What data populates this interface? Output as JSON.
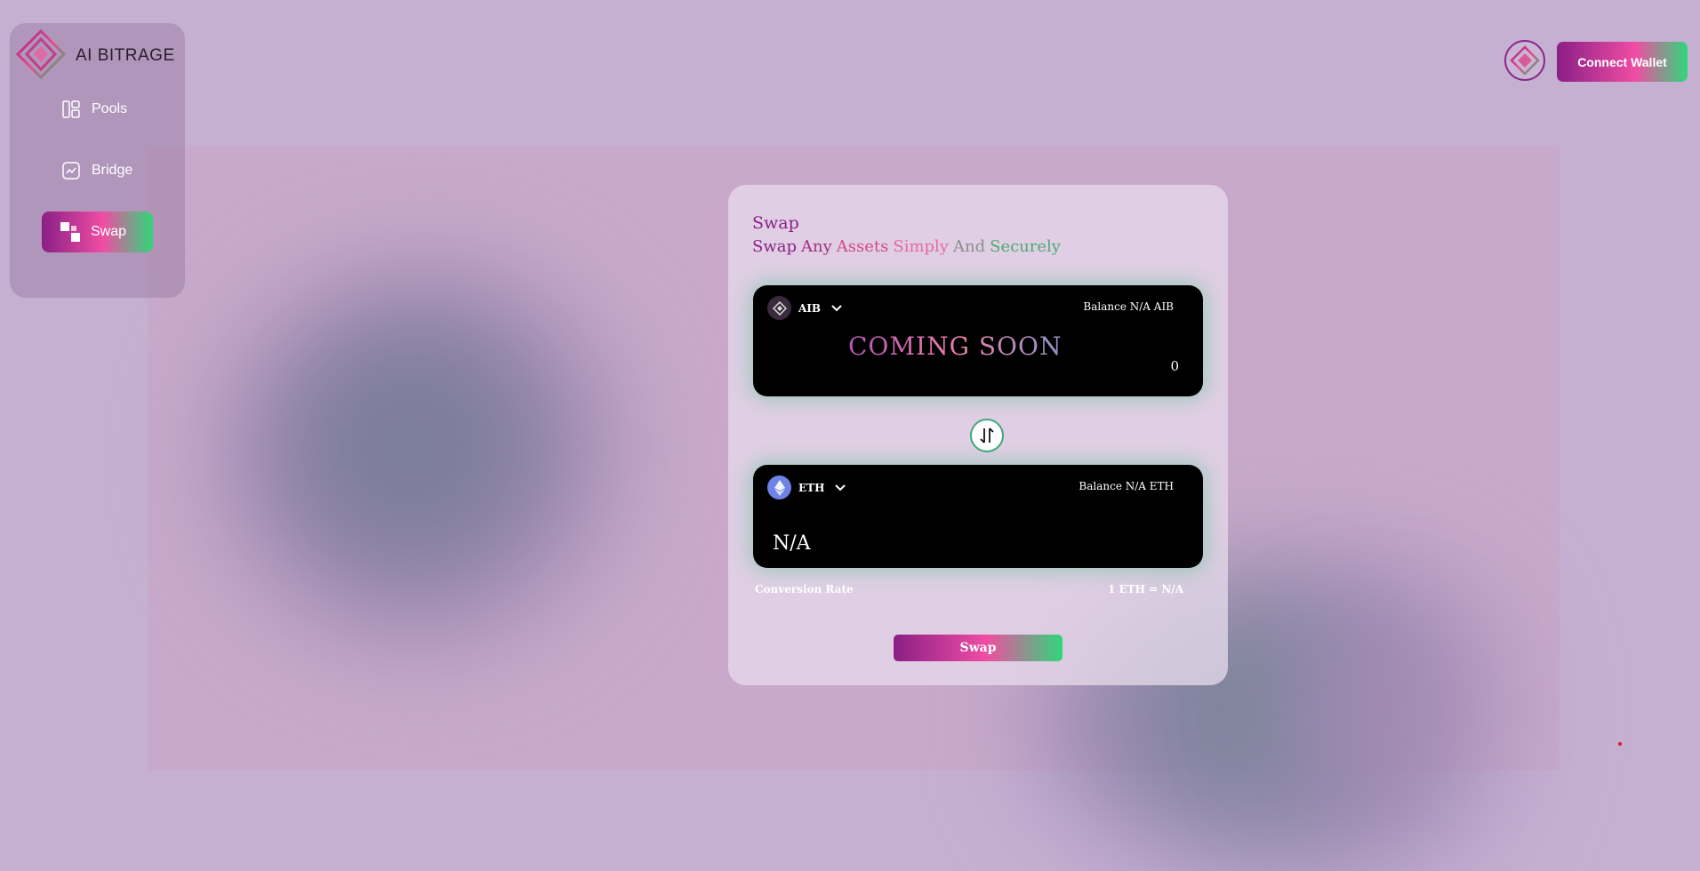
{
  "brand": {
    "name": "AI BITRAGE",
    "logo_icon": "diamond-logo-icon"
  },
  "sidebar": {
    "items": [
      {
        "label": "Pools",
        "icon": "pools-icon"
      },
      {
        "label": "Bridge",
        "icon": "bridge-icon"
      },
      {
        "label": "Swap",
        "icon": "swap-icon",
        "active": true
      }
    ]
  },
  "header": {
    "connect_label": "Connect Wallet"
  },
  "swap_card": {
    "title": "Swap",
    "subtitle_words": [
      "Swap",
      "Any",
      "Assets",
      "Simply",
      "And",
      "Securely"
    ],
    "from": {
      "token": "AIB",
      "balance": "Balance N/A AIB",
      "overlay": "COMING SOON",
      "amount": "0"
    },
    "to": {
      "token": "ETH",
      "balance": "Balance N/A ETH",
      "amount": "N/A"
    },
    "conversion_label": "Conversion Rate",
    "conversion_value": "1 ETH = N/A",
    "swap_label": "Swap"
  },
  "colors": {
    "accent_purple": "#8a1f86",
    "accent_pink": "#f04da3",
    "accent_green": "#2fd77a"
  }
}
